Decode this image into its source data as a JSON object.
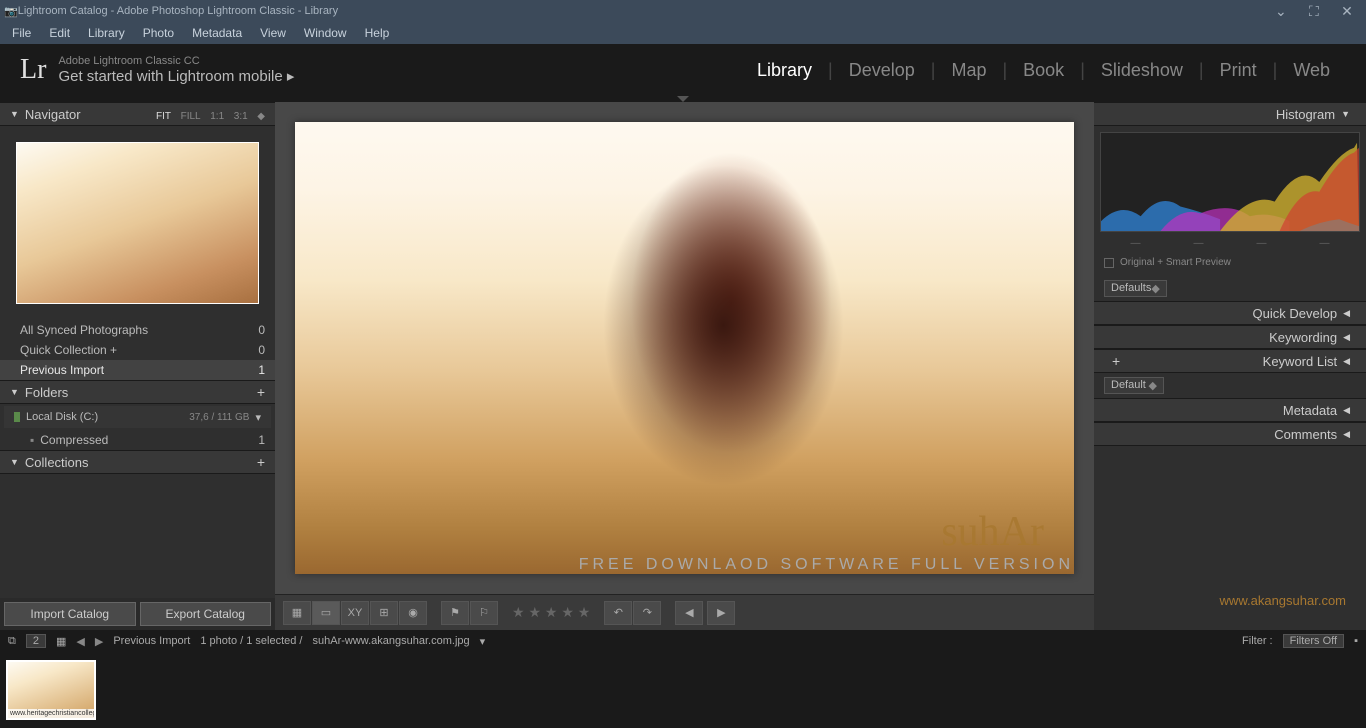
{
  "title": "Lightroom Catalog - Adobe Photoshop Lightroom Classic - Library",
  "menus": [
    "File",
    "Edit",
    "Library",
    "Photo",
    "Metadata",
    "View",
    "Window",
    "Help"
  ],
  "brand_line1": "Adobe Lightroom Classic CC",
  "brand_line2": "Get started with Lightroom mobile  ▸",
  "modules": [
    "Library",
    "Develop",
    "Map",
    "Book",
    "Slideshow",
    "Print",
    "Web"
  ],
  "active_module": "Library",
  "left": {
    "navigator": "Navigator",
    "zoom": [
      "FIT",
      "FILL",
      "1:1",
      "3:1"
    ],
    "catalog": [
      {
        "label": "All Synced Photographs",
        "count": 0
      },
      {
        "label": "Quick Collection  +",
        "count": 0
      },
      {
        "label": "Previous Import",
        "count": 1,
        "selected": true
      }
    ],
    "folders": "Folders",
    "volume": {
      "name": "Local Disk (C:)",
      "size": "37,6 / 111 GB"
    },
    "folder_rows": [
      {
        "name": "Compressed",
        "count": 1
      }
    ],
    "collections": "Collections",
    "import": "Import Catalog",
    "export": "Export Catalog"
  },
  "right": {
    "histogram": "Histogram",
    "preview_label": "Original + Smart Preview",
    "quick_develop": "Quick Develop",
    "defaults": "Defaults",
    "keywording": "Keywording",
    "keyword_list": "Keyword List",
    "metadata": "Metadata",
    "metadata_sel": "Default",
    "comments": "Comments"
  },
  "toolbar": {
    "rotate": "↻"
  },
  "filter": {
    "label": "Filter :",
    "value": "Filters Off"
  },
  "filmbar": {
    "source": "Previous Import",
    "stats": "1 photo / 1 selected /",
    "filename": "suhAr-www.akangsuhar.com.jpg",
    "thumb_caption": "www.heritagechristiancollege.com",
    "page": "2"
  },
  "watermark": {
    "brand": "suhAr",
    "url": "www.akangsuhar.com",
    "slogan": "FREE DOWNLAOD SOFTWARE FULL VERSION"
  }
}
